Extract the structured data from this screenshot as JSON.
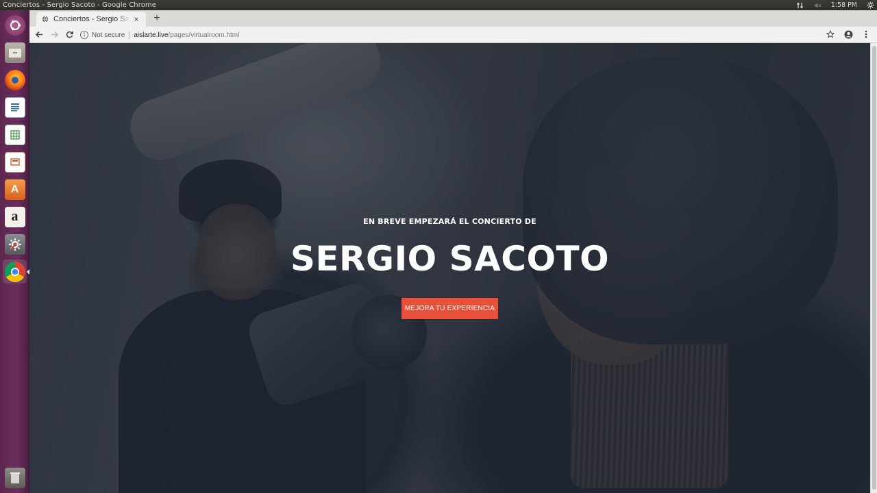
{
  "system": {
    "window_title": "Conciertos - Sergio Sacoto - Google Chrome",
    "time": "1:58 PM",
    "tray_icons": [
      "network-icon",
      "volume-muted-icon",
      "settings-icon"
    ]
  },
  "launcher": {
    "items": [
      "ubuntu-dash-icon",
      "files-icon",
      "firefox-icon",
      "writer-icon",
      "calc-icon",
      "impress-icon",
      "software-center-icon",
      "amazon-icon",
      "system-settings-icon",
      "chrome-icon",
      "trash-icon"
    ]
  },
  "browser": {
    "tab_title": "Conciertos - Sergio Sacoto",
    "new_tab_label": "+",
    "security_label": "Not secure",
    "url_host": "aislarte.live",
    "url_path": "/pages/virtualroom.html"
  },
  "hero": {
    "kicker": "EN BREVE EMPEZARÁ EL CONCIERTO DE",
    "title": "SERGIO SACOTO",
    "cta_label": "MEJORA TU EXPERIENCIA",
    "cta_color": "#e8503a"
  }
}
